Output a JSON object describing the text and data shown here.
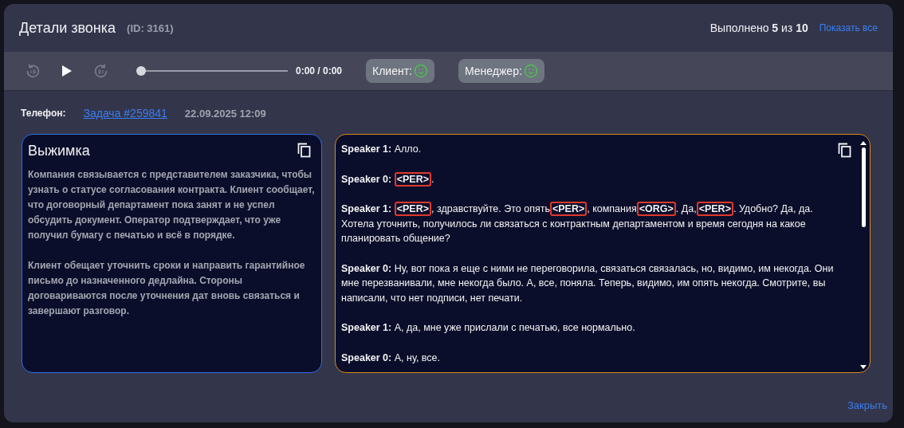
{
  "dialog": {
    "title": "Детали звонка",
    "id_label": "(ID: 3161)",
    "progress": "Выполнено **5** из **10**",
    "show_all": "Показать все"
  },
  "player": {
    "time": "0:00 / 0:00",
    "level": 0,
    "sentiments": [
      {
        "label": "Клиент:",
        "happy": true
      },
      {
        "label": "Менеджер:",
        "happy": true
      }
    ]
  },
  "info": {
    "phone_label": "Телефон:",
    "task_link": "Задача #259841",
    "datetime": "22.09.2025 12:09"
  },
  "summary": {
    "title": "Выжимка",
    "paragraphs": [
      "Компания связывается с представителем заказчика, чтобы узнать о статусе согласования контракта. Клиент сообщает, что договорный департамент пока занят и не успел обсудить документ. Оператор подтверждает, что уже получил бумагу с печатью и всё в порядке.",
      "Клиент обещает уточнить сроки и направить гарантийное письмо до назначенного дедлайна. Стороны договариваются после уточнения дат вновь связаться и завершают разговор."
    ]
  },
  "transcript": [
    {
      "speaker": "Speaker 1:",
      "parts": [
        {
          "kind": "text",
          "text": "Алло."
        }
      ]
    },
    {
      "speaker": "Speaker 0:",
      "parts": [
        {
          "kind": "tag",
          "text": "<PER>"
        },
        {
          "kind": "text",
          "text": "."
        }
      ]
    },
    {
      "speaker": "Speaker 1:",
      "parts": [
        {
          "kind": "tag",
          "text": "<PER>"
        },
        {
          "kind": "text",
          "text": ", здравствуйте.  Это опять"
        },
        {
          "kind": "tag",
          "text": "<PER>"
        },
        {
          "kind": "text",
          "text": ", компания"
        },
        {
          "kind": "tag",
          "text": "<ORG>"
        },
        {
          "kind": "text",
          "text": ".  Да,"
        },
        {
          "kind": "tag",
          "text": "<PER>"
        },
        {
          "kind": "text",
          "text": ".  Удобно?  Да, да.  Хотела уточнить, получилось ли связаться с контрактным департаментом и время сегодня на какое планировать общение?"
        }
      ]
    },
    {
      "speaker": "Speaker 0:",
      "parts": [
        {
          "kind": "text",
          "text": "Ну, вот пока я еще с ними не переговорила, связаться связалась, но, видимо, им некогда.  Они мне перезванивали, мне некогда было.  А, все, поняла.  Теперь, видимо, им опять некогда.  Смотрите, вы написали, что нет подписи, нет печати."
        }
      ]
    },
    {
      "speaker": "Speaker 1:",
      "parts": [
        {
          "kind": "text",
          "text": "А, да, мне уже прислали с печатью, все нормально."
        }
      ]
    },
    {
      "speaker": "Speaker 0:",
      "parts": [
        {
          "kind": "text",
          "text": "А, ну, все."
        }
      ]
    }
  ],
  "close": "Закрыть"
}
